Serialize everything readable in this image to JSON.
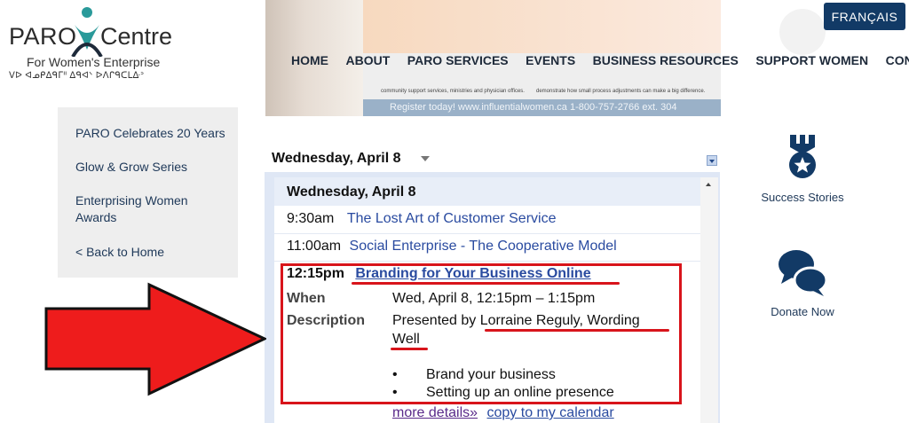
{
  "logo": {
    "paro": "PARO",
    "centre": "Centre",
    "tagline": "For Women's Enterprise",
    "syllabics": "ᐯᐅ ᐊᓄᑭᐃᑫᒥᐦ ᐃᑫᐊᐠ ᐅᐱᒋᑫᑕᒪᐏᐣ"
  },
  "banner": {
    "note_left": "community support services, ministries and physician offices.",
    "note_right": "demonstrate how small process adjustments can make a big difference.",
    "strip": "Register today! www.influentialwomen.ca     1-800-757-2766 ext. 304"
  },
  "lang_button": "FRANÇAIS",
  "nav": [
    "HOME",
    "ABOUT",
    "PARO SERVICES",
    "EVENTS",
    "BUSINESS RESOURCES",
    "SUPPORT WOMEN",
    "CONTACT"
  ],
  "sidebar": {
    "items": [
      "PARO Celebrates 20 Years",
      "Glow & Grow Series",
      "Enterprising Women Awards",
      "< Back to Home"
    ]
  },
  "calendar": {
    "date_selector": "Wednesday, April 8",
    "day_header": "Wednesday, April 8",
    "events": [
      {
        "time": "9:30am",
        "title": "The Lost Art of Customer Service"
      },
      {
        "time": "11:00am",
        "title": "Social Enterprise - The Cooperative Model"
      },
      {
        "time": "12:15pm",
        "title": "Branding for Your Business Online"
      }
    ],
    "detail": {
      "when_label": "When",
      "when_value": "Wed, April 8, 12:15pm – 1:15pm",
      "description_label": "Description",
      "description_line1": "Presented by Lorraine Reguly, Wording",
      "description_line2": "Well",
      "bullets": [
        "Brand your business",
        "Setting up an online presence"
      ],
      "bullet_glyph": "•",
      "more_details": "more details»",
      "copy_to_calendar": "copy to my calendar"
    }
  },
  "right_sidebar": {
    "success": "Success Stories",
    "donate": "Donate Now"
  },
  "colors": {
    "navy": "#123a66",
    "annotation_red": "#d8141b",
    "link_blue": "#2a4ba0"
  }
}
